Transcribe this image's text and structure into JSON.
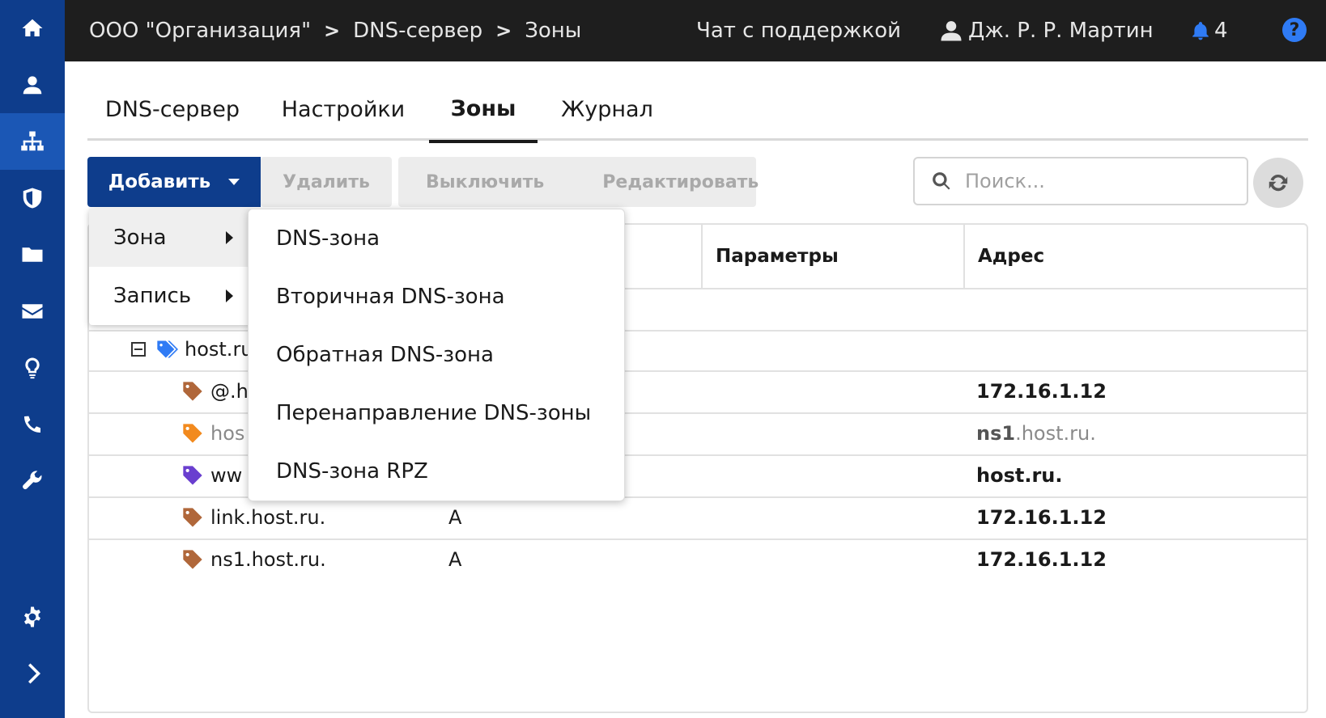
{
  "sidebar": {
    "items": [
      {
        "icon": "home-icon"
      },
      {
        "icon": "user-icon"
      },
      {
        "icon": "network-icon",
        "active": true
      },
      {
        "icon": "shield-icon"
      },
      {
        "icon": "folder-icon"
      },
      {
        "icon": "mail-icon"
      },
      {
        "icon": "lightbulb-icon"
      },
      {
        "icon": "phone-icon"
      },
      {
        "icon": "wrench-icon"
      }
    ],
    "bottom": [
      {
        "icon": "gear-icon"
      },
      {
        "icon": "chevron-right-icon"
      }
    ],
    "accent": "#0e3d8c",
    "active_color": "#1b57b5"
  },
  "header": {
    "breadcrumb": [
      "ООО \"Организация\"",
      "DNS-сервер",
      "Зоны"
    ],
    "separator": ">",
    "support": "Чат с поддержкой",
    "user": "Дж. Р. Р. Мартин",
    "notifications": "4",
    "help": "?"
  },
  "tabs": [
    {
      "label": "DNS-сервер"
    },
    {
      "label": "Настройки"
    },
    {
      "label": "Зоны",
      "active": true
    },
    {
      "label": "Журнал"
    }
  ],
  "toolbar": {
    "add": "Добавить",
    "delete": "Удалить",
    "disable": "Выключить",
    "edit": "Редактировать",
    "search_placeholder": "Поиск..."
  },
  "table": {
    "columns": [
      "Параметры",
      "Адрес"
    ],
    "rows": [
      {
        "name": "host.ru",
        "type": "",
        "address": "",
        "tag_color": "#2f7bf5",
        "level": 0
      },
      {
        "name": "@.h",
        "type": "",
        "address": "172.16.1.12",
        "tag_color": "#b0673a",
        "level": 1
      },
      {
        "name": "hos",
        "type": "",
        "address_bold": "ns1",
        "address_rest": ".host.ru.",
        "tag_color": "#f28a1e",
        "level": 1,
        "muted": true
      },
      {
        "name": "ww",
        "type": "",
        "address": "host.ru.",
        "tag_color": "#6a3fcf",
        "level": 1
      },
      {
        "name": "link.host.ru.",
        "type": "A",
        "address": "172.16.1.12",
        "tag_color": "#b0673a",
        "level": 1
      },
      {
        "name": "ns1.host.ru.",
        "type": "A",
        "address": "172.16.1.12",
        "tag_color": "#b0673a",
        "level": 1
      }
    ]
  },
  "menu": {
    "items": [
      {
        "label": "Зона",
        "active": true
      },
      {
        "label": "Запись"
      }
    ],
    "submenu": [
      "DNS-зона",
      "Вторичная DNS-зона",
      "Обратная DNS-зона",
      "Перенаправление DNS-зоны",
      "DNS-зона RPZ"
    ]
  }
}
